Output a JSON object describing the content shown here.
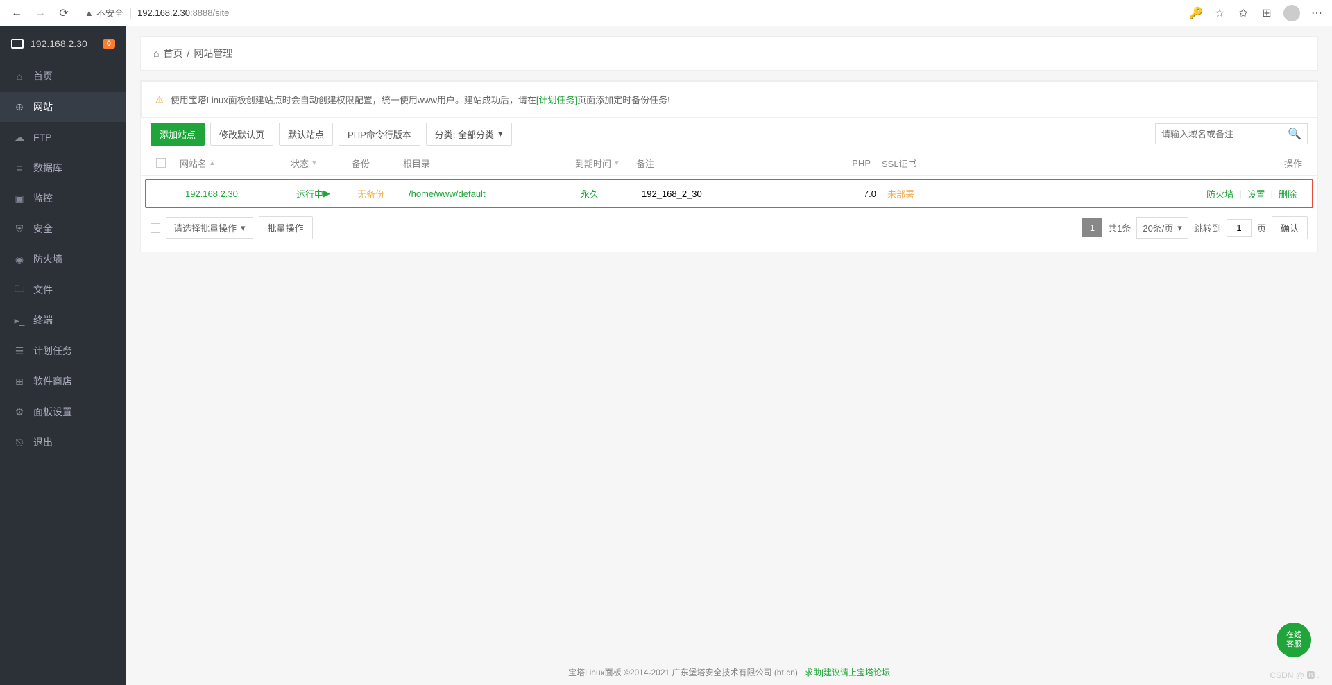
{
  "browser": {
    "url_host": "192.168.2.30",
    "url_port": ":8888",
    "url_path": "/site",
    "insecure_label": "不安全"
  },
  "sidebar": {
    "header_ip": "192.168.2.30",
    "badge": "0",
    "items": [
      {
        "label": "首页",
        "icon": "home"
      },
      {
        "label": "网站",
        "icon": "globe"
      },
      {
        "label": "FTP",
        "icon": "ftp"
      },
      {
        "label": "数据库",
        "icon": "db"
      },
      {
        "label": "监控",
        "icon": "monitor"
      },
      {
        "label": "安全",
        "icon": "shield"
      },
      {
        "label": "防火墙",
        "icon": "firewall"
      },
      {
        "label": "文件",
        "icon": "folder"
      },
      {
        "label": "终端",
        "icon": "terminal"
      },
      {
        "label": "计划任务",
        "icon": "task"
      },
      {
        "label": "软件商店",
        "icon": "store"
      },
      {
        "label": "面板设置",
        "icon": "settings"
      },
      {
        "label": "退出",
        "icon": "logout"
      }
    ]
  },
  "breadcrumb": {
    "home": "首页",
    "sep": "/",
    "current": "网站管理"
  },
  "notice": {
    "pre": "使用宝塔Linux面板创建站点时会自动创建权限配置，统一使用www用户。建站成功后，请在",
    "link": "[计划任务]",
    "post": "页面添加定时备份任务!"
  },
  "toolbar": {
    "add": "添加站点",
    "default_mod": "修改默认页",
    "default_site": "默认站点",
    "php_cli": "PHP命令行版本",
    "filter": "分类: 全部分类",
    "search_placeholder": "请输入域名或备注"
  },
  "table": {
    "headers": {
      "name": "网站名",
      "status": "状态",
      "backup": "备份",
      "root": "根目录",
      "expire": "到期时间",
      "note": "备注",
      "php": "PHP",
      "ssl": "SSL证书",
      "action": "操作"
    },
    "row": {
      "name": "192.168.2.30",
      "status": "运行中",
      "backup": "无备份",
      "root": "/home/www/default",
      "expire": "永久",
      "note": "192_168_2_30",
      "php": "7.0",
      "ssl": "未部署",
      "a_fw": "防火墙",
      "a_set": "设置",
      "a_del": "删除"
    }
  },
  "bottom": {
    "bulk_placeholder": "请选择批量操作",
    "bulk_btn": "批量操作",
    "page": "1",
    "total": "共1条",
    "per_page": "20条/页",
    "jump_pre": "跳转到",
    "jump_val": "1",
    "jump_suf": "页",
    "confirm": "确认"
  },
  "footer": {
    "copy": "宝塔Linux面板 ©2014-2021 广东堡塔安全技术有限公司 (bt.cn)",
    "help": "求助|建议请上宝塔论坛"
  },
  "float": "在线\n客服",
  "watermark": "CSDN @ 🅱 ."
}
